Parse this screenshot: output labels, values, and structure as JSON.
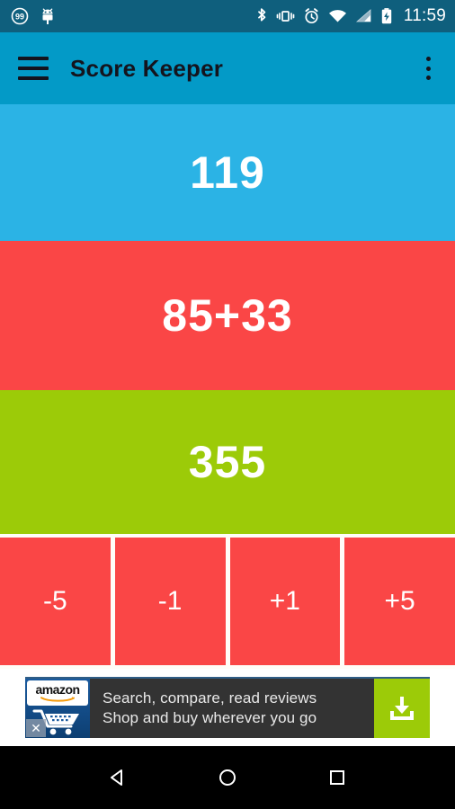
{
  "status_bar": {
    "background": "#0f5f7d",
    "left_icons": [
      {
        "name": "notification-count-99-icon",
        "label": "99"
      },
      {
        "name": "android-bug-icon",
        "label": ""
      }
    ],
    "right_icons": [
      {
        "name": "bluetooth-icon"
      },
      {
        "name": "vibrate-icon"
      },
      {
        "name": "alarm-clock-icon"
      },
      {
        "name": "wifi-icon"
      },
      {
        "name": "cellular-signal-icon"
      },
      {
        "name": "battery-charging-icon"
      }
    ],
    "time": "11:59"
  },
  "app_bar": {
    "background": "#039ac7",
    "menu_icon": "hamburger-menu-icon",
    "title": "Score Keeper",
    "overflow_icon": "overflow-menu-icon"
  },
  "panels": [
    {
      "name": "score-panel-blue",
      "score": "119",
      "color": "#2bb3e5"
    },
    {
      "name": "score-panel-red",
      "score": "85+33",
      "color": "#fa4646"
    },
    {
      "name": "score-panel-green",
      "score": "355",
      "color": "#9ccb08"
    }
  ],
  "buttons": [
    {
      "name": "score-button-minus-5",
      "label": "-5"
    },
    {
      "name": "score-button-minus-1",
      "label": "-1"
    },
    {
      "name": "score-button-plus-1",
      "label": "+1"
    },
    {
      "name": "score-button-plus-5",
      "label": "+5"
    }
  ],
  "button_color": "#fa4646",
  "ad": {
    "brand": "amazon",
    "line1": "Search, compare, read reviews",
    "line2": "Shop and buy wherever you go",
    "close_label": "✕",
    "cta_icon": "download-icon",
    "cta_color": "#9ccb08",
    "background": "#333333"
  },
  "nav_bar": {
    "background": "#000000",
    "buttons": [
      {
        "name": "nav-back-button",
        "icon": "back-triangle-icon"
      },
      {
        "name": "nav-home-button",
        "icon": "home-circle-icon"
      },
      {
        "name": "nav-recents-button",
        "icon": "recents-square-icon"
      }
    ]
  }
}
